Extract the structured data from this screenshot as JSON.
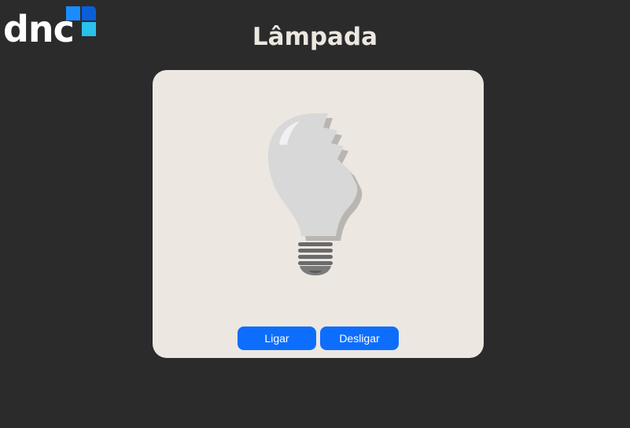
{
  "logo": {
    "text": "dnc",
    "icon": "dnc-logo-squares-icon",
    "colors": [
      "#1a8cff",
      "#29b6e8",
      "#0a5fd8"
    ]
  },
  "header": {
    "title": "Lâmpada"
  },
  "lamp": {
    "icon": "broken-lightbulb-icon",
    "state": "broken"
  },
  "buttons": {
    "on_label": "Ligar",
    "off_label": "Desligar",
    "color": "#0d6efd"
  }
}
